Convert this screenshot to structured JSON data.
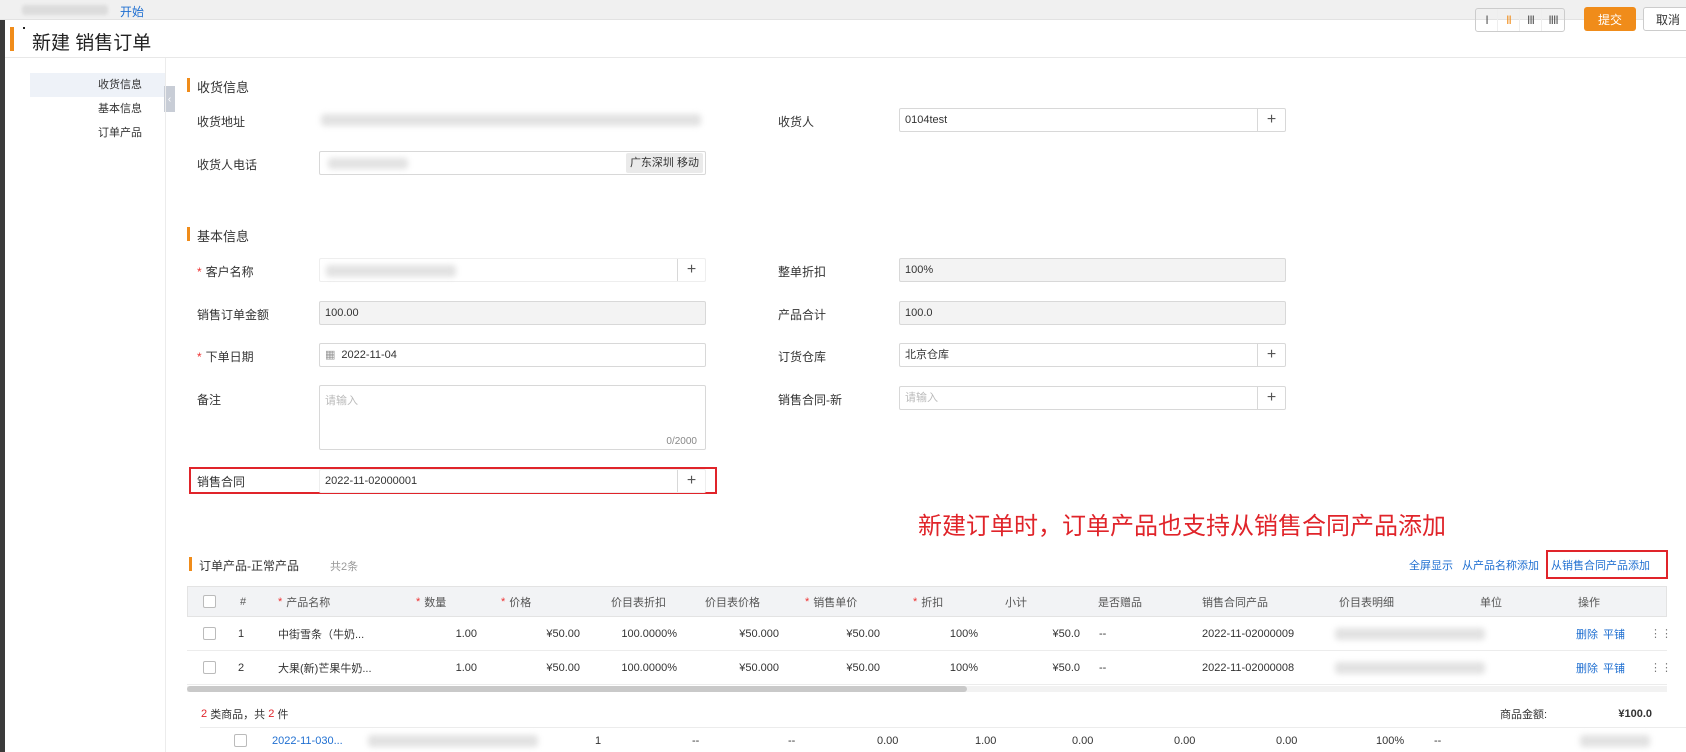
{
  "topbar": {
    "start_label": "开始"
  },
  "header": {
    "title": "新建 销售订单",
    "layout_options": [
      "I",
      "II",
      "III",
      "IIII"
    ],
    "submit_label": "提交",
    "cancel_label": "取消"
  },
  "anchor_nav": {
    "items": [
      "收货信息",
      "基本信息",
      "订单产品"
    ],
    "collapse_icon": "chevron-left-icon"
  },
  "shipping": {
    "title": "收货信息",
    "address_label": "收货地址",
    "receiver_label": "收货人",
    "receiver_value": "0104test",
    "phone_label": "收货人电话",
    "phone_location_tag": "广东深圳 移动"
  },
  "basic": {
    "title": "基本信息",
    "customer_label": "客户名称",
    "discount_label": "整单折扣",
    "discount_value": "100%",
    "amount_label": "销售订单金额",
    "amount_value": "100.00",
    "product_total_label": "产品合计",
    "product_total_value": "100.0",
    "order_date_label": "下单日期",
    "order_date_value": "2022-11-04",
    "warehouse_label": "订货仓库",
    "warehouse_value": "北京仓库",
    "remark_label": "备注",
    "remark_placeholder": "请输入",
    "remark_count": "0/2000",
    "contract_new_label": "销售合同-新",
    "contract_new_placeholder": "请输入",
    "contract_label": "销售合同",
    "contract_value": "2022-11-02000001"
  },
  "annotation": "新建订单时，订单产品也支持从销售合同产品添加",
  "products": {
    "title": "订单产品-正常产品",
    "count_text": "共2条",
    "links": [
      "全屏显示",
      "从产品名称添加",
      "从销售合同产品添加"
    ],
    "columns": [
      "#",
      "产品名称",
      "数量",
      "价格",
      "价目表折扣",
      "价目表价格",
      "销售单价",
      "折扣",
      "小计",
      "是否赠品",
      "销售合同产品",
      "价目表明细",
      "单位",
      "操作"
    ],
    "rows": [
      {
        "idx": "1",
        "name": "中街雪条（牛奶...",
        "qty": "1.00",
        "price": "¥50.00",
        "pl_discount": "100.0000%",
        "pl_price": "¥50.000",
        "unit_price": "¥50.00",
        "discount": "100%",
        "subtotal": "¥50.0",
        "gift": "--",
        "contract_product": "2022-11-02000009",
        "delete": "删除",
        "tile": "平铺"
      },
      {
        "idx": "2",
        "name": "大果(新)芒果牛奶...",
        "qty": "1.00",
        "price": "¥50.00",
        "pl_discount": "100.0000%",
        "pl_price": "¥50.000",
        "unit_price": "¥50.00",
        "discount": "100%",
        "subtotal": "¥50.0",
        "gift": "--",
        "contract_product": "2022-11-02000008",
        "delete": "删除",
        "tile": "平铺"
      }
    ],
    "footer_kinds": "2",
    "footer_kinds_suffix": "类商品，共",
    "footer_items": "2",
    "footer_items_suffix": "件",
    "footer_amount_label": "商品金额:",
    "footer_amount_value": "¥100.0"
  },
  "bottom_row": {
    "link": "2022-11-030...",
    "values": [
      "1",
      "--",
      "--",
      "0.00",
      "1.00",
      "0.00",
      "0.00",
      "0.00",
      "100%",
      "--"
    ]
  }
}
